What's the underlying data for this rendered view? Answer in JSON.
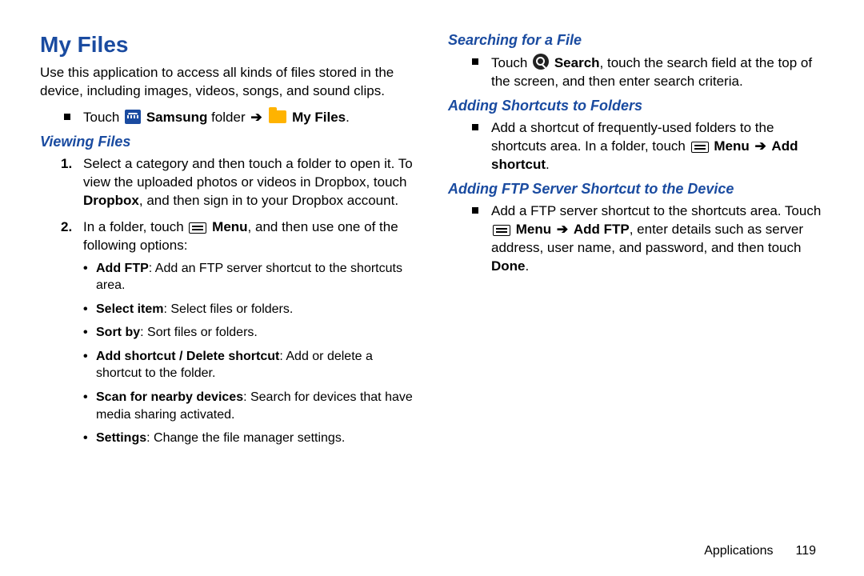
{
  "title": "My Files",
  "intro": "Use this application to access all kinds of files stored in the device, including images, videos, songs, and sound clips.",
  "nav": {
    "touch": "Touch ",
    "samsung": "Samsung",
    "folder_word": " folder ",
    "myfiles": "My Files",
    "period": "."
  },
  "sections": {
    "viewing": "Viewing Files",
    "searching": "Searching for a File",
    "shortcuts": "Adding Shortcuts to Folders",
    "ftp": "Adding FTP Server Shortcut to the Device"
  },
  "view_steps": {
    "s1a": "Select a category and then touch a folder to open it. To view the uploaded photos or videos in Dropbox, touch ",
    "s1b": "Dropbox",
    "s1c": ", and then sign in to your Dropbox account.",
    "s2a": "In a folder, touch ",
    "s2b": "Menu",
    "s2c": ", and then use one of the following options:"
  },
  "options": {
    "o1a": "Add FTP",
    "o1b": ": Add an FTP server shortcut to the shortcuts area.",
    "o2a": "Select item",
    "o2b": ": Select files or folders.",
    "o3a": "Sort by",
    "o3b": ": Sort files or folders.",
    "o4a": "Add shortcut / Delete shortcut",
    "o4b": ": Add or delete a shortcut to the folder.",
    "o5a": "Scan for nearby devices",
    "o5b": ": Search for devices that have media sharing activated.",
    "o6a": "Settings",
    "o6b": ": Change the file manager settings."
  },
  "search": {
    "a": "Touch ",
    "b": "Search",
    "c": ", touch the search field at the top of the screen, and then enter search criteria."
  },
  "shortcut": {
    "a": "Add a shortcut of frequently-used folders to the shortcuts area. In a folder, touch ",
    "b": "Menu",
    "arrow": " ➔ ",
    "c": "Add shortcut",
    "d": "."
  },
  "ftp": {
    "a": "Add a FTP server shortcut to the shortcuts area. Touch ",
    "b": "Menu",
    "arrow": " ➔ ",
    "c": "Add FTP",
    "d": ", enter details such as server address, user name, and password, and then touch ",
    "e": "Done",
    "f": "."
  },
  "footer": {
    "section": "Applications",
    "page": "119"
  }
}
